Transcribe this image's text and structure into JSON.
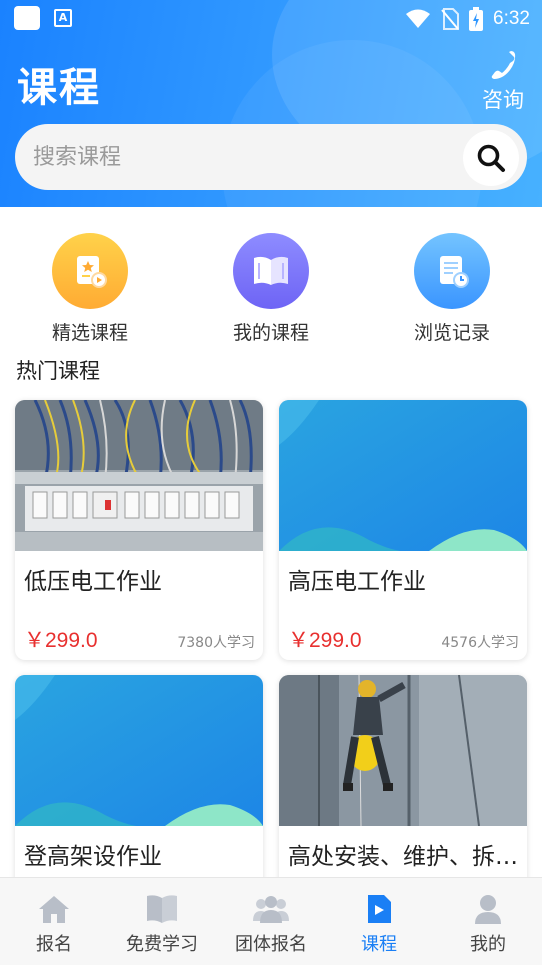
{
  "status_bar": {
    "time": "6:32",
    "app_icon_letter": "A"
  },
  "header": {
    "title": "课程",
    "consult_label": "咨询",
    "search_placeholder": "搜索课程"
  },
  "quick_nav": [
    {
      "label": "精选课程",
      "icon": "featured-course-icon",
      "color_from": "#ffd24a",
      "color_to": "#ffab33"
    },
    {
      "label": "我的课程",
      "icon": "book-icon",
      "color_from": "#8e8cff",
      "color_to": "#6e64f5"
    },
    {
      "label": "浏览记录",
      "icon": "history-icon",
      "color_from": "#74c4ff",
      "color_to": "#3a95ff"
    }
  ],
  "section_title": "热门课程",
  "courses": [
    {
      "title": "低压电工作业",
      "price": "￥299.0",
      "learners": "7380人学习",
      "image": "electrical-panel-photo"
    },
    {
      "title": "高压电工作业",
      "price": "￥299.0",
      "learners": "4576人学习",
      "image": "blue-placeholder"
    },
    {
      "title": "登高架设作业",
      "price": "",
      "learners": "",
      "image": "blue-placeholder"
    },
    {
      "title": "高处安装、维护、拆…",
      "price": "",
      "learners": "",
      "image": "high-altitude-worker-photo"
    }
  ],
  "bottom_nav": [
    {
      "label": "报名",
      "icon": "home-icon",
      "active": false
    },
    {
      "label": "免费学习",
      "icon": "open-book-icon",
      "active": false
    },
    {
      "label": "团体报名",
      "icon": "group-icon",
      "active": false
    },
    {
      "label": "课程",
      "icon": "play-course-icon",
      "active": true
    },
    {
      "label": "我的",
      "icon": "user-icon",
      "active": false
    }
  ],
  "colors": {
    "primary": "#1a7ff5",
    "price": "#e8302f",
    "inactive_icon": "#b8bec8"
  }
}
